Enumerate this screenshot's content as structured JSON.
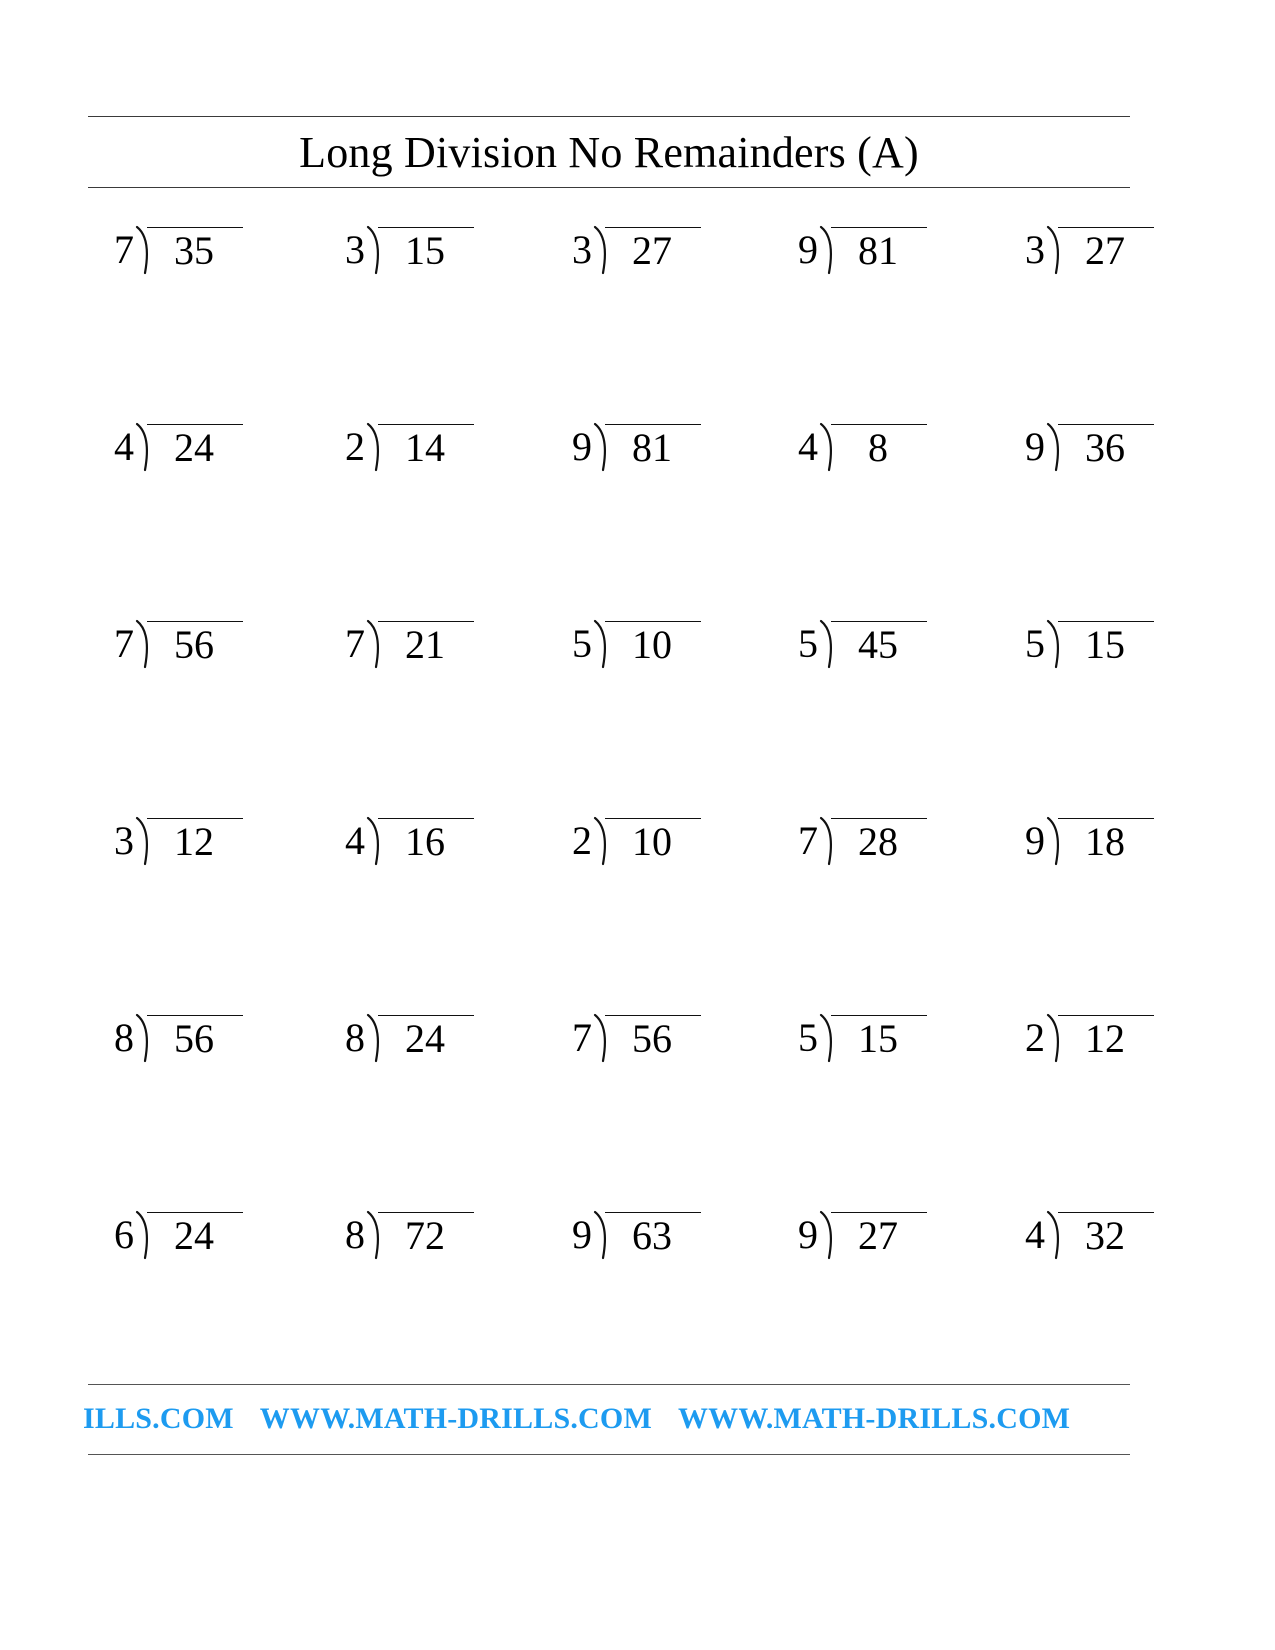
{
  "worksheet": {
    "title": "Long Division No Remainders (A)",
    "operator_symbol": ")",
    "rows": [
      [
        {
          "divisor": "7",
          "dividend": "35"
        },
        {
          "divisor": "3",
          "dividend": "15"
        },
        {
          "divisor": "3",
          "dividend": "27"
        },
        {
          "divisor": "9",
          "dividend": "81"
        },
        {
          "divisor": "3",
          "dividend": "27"
        }
      ],
      [
        {
          "divisor": "4",
          "dividend": "24"
        },
        {
          "divisor": "2",
          "dividend": "14"
        },
        {
          "divisor": "9",
          "dividend": "81"
        },
        {
          "divisor": "4",
          "dividend": "8"
        },
        {
          "divisor": "9",
          "dividend": "36"
        }
      ],
      [
        {
          "divisor": "7",
          "dividend": "56"
        },
        {
          "divisor": "7",
          "dividend": "21"
        },
        {
          "divisor": "5",
          "dividend": "10"
        },
        {
          "divisor": "5",
          "dividend": "45"
        },
        {
          "divisor": "5",
          "dividend": "15"
        }
      ],
      [
        {
          "divisor": "3",
          "dividend": "12"
        },
        {
          "divisor": "4",
          "dividend": "16"
        },
        {
          "divisor": "2",
          "dividend": "10"
        },
        {
          "divisor": "7",
          "dividend": "28"
        },
        {
          "divisor": "9",
          "dividend": "18"
        }
      ],
      [
        {
          "divisor": "8",
          "dividend": "56"
        },
        {
          "divisor": "8",
          "dividend": "24"
        },
        {
          "divisor": "7",
          "dividend": "56"
        },
        {
          "divisor": "5",
          "dividend": "15"
        },
        {
          "divisor": "2",
          "dividend": "12"
        }
      ],
      [
        {
          "divisor": "6",
          "dividend": "24"
        },
        {
          "divisor": "8",
          "dividend": "72"
        },
        {
          "divisor": "9",
          "dividend": "63"
        },
        {
          "divisor": "9",
          "dividend": "27"
        },
        {
          "divisor": "4",
          "dividend": "32"
        }
      ]
    ]
  },
  "footer": {
    "color": "#1d9bf0",
    "items": [
      "ILLS.COM",
      "WWW.MATH-DRILLS.COM",
      "WWW.MATH-DRILLS.COM"
    ]
  }
}
